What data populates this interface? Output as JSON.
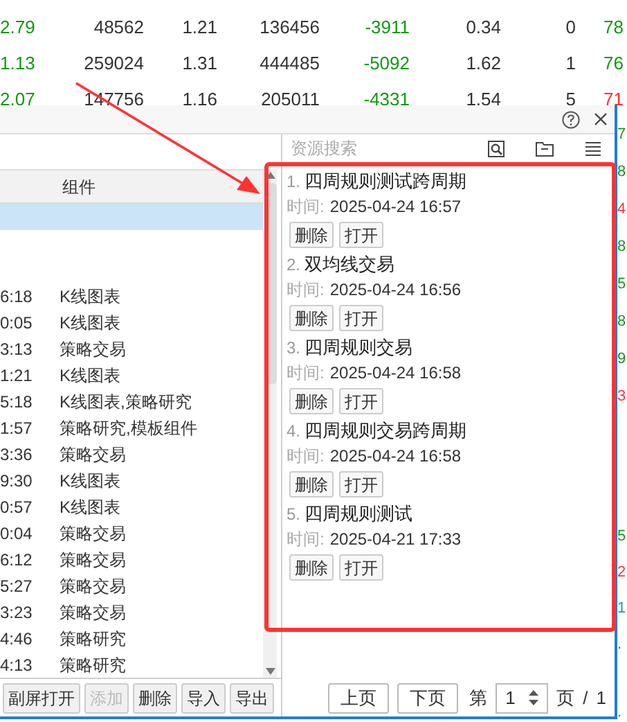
{
  "background_table": {
    "rows": [
      {
        "cells": [
          {
            "text": "2.79",
            "color": "#119911"
          },
          {
            "text": "48562",
            "color": "#333333"
          },
          {
            "text": "1.21",
            "color": "#333333"
          },
          {
            "text": "136456",
            "color": "#333333"
          },
          {
            "text": "-3911",
            "color": "#119911"
          },
          {
            "text": "0.34",
            "color": "#333333"
          },
          {
            "text": "0",
            "color": "#333333"
          },
          {
            "text": "78",
            "color": "#119911"
          }
        ]
      },
      {
        "cells": [
          {
            "text": "1.13",
            "color": "#119911"
          },
          {
            "text": "259024",
            "color": "#333333"
          },
          {
            "text": "1.31",
            "color": "#333333"
          },
          {
            "text": "444485",
            "color": "#333333"
          },
          {
            "text": "-5092",
            "color": "#119911"
          },
          {
            "text": "1.62",
            "color": "#333333"
          },
          {
            "text": "1",
            "color": "#333333"
          },
          {
            "text": "76",
            "color": "#119911"
          }
        ]
      },
      {
        "cells": [
          {
            "text": "2.07",
            "color": "#119911"
          },
          {
            "text": "147756",
            "color": "#333333"
          },
          {
            "text": "1.16",
            "color": "#333333"
          },
          {
            "text": "205011",
            "color": "#333333"
          },
          {
            "text": "-4331",
            "color": "#119911"
          },
          {
            "text": "1.54",
            "color": "#333333"
          },
          {
            "text": "5",
            "color": "#333333"
          },
          {
            "text": "71",
            "color": "#ff3333"
          }
        ]
      }
    ]
  },
  "right_edge_fragments": {
    "upper": [
      {
        "text": "7",
        "color": "#119911"
      },
      {
        "text": "8",
        "color": "#119911"
      },
      {
        "text": "4",
        "color": "#ff3333"
      },
      {
        "text": "8",
        "color": "#119911"
      },
      {
        "text": "5",
        "color": "#119911"
      },
      {
        "text": "8",
        "color": "#119911"
      },
      {
        "text": "9",
        "color": "#119911"
      },
      {
        "text": "3",
        "color": "#ff3333"
      }
    ],
    "lower": [
      {
        "text": "5",
        "color": "#119911"
      },
      {
        "text": "2",
        "color": "#ff3333"
      },
      {
        "text": "1",
        "color": "#1a9fb0"
      },
      {
        "text": ".",
        "color": "#119911"
      }
    ],
    "bottom": [
      {
        "text": ".",
        "color": "#119911"
      }
    ]
  },
  "dialog": {
    "left_panel": {
      "columns": [
        "组件"
      ],
      "rows": [
        {
          "selected": true
        },
        {
          "time": "6:18",
          "component": "K线图表",
          "selected": false
        },
        {
          "time": "0:05",
          "component": "K线图表",
          "selected": false
        },
        {
          "time": "3:13",
          "component": "策略交易",
          "selected": false
        },
        {
          "time": "1:21",
          "component": "K线图表",
          "selected": false
        },
        {
          "time": "5:18",
          "component": "K线图表,策略研究",
          "selected": false
        },
        {
          "time": "1:57",
          "component": "策略研究,模板组件",
          "selected": false
        },
        {
          "time": "3:36",
          "component": "策略交易",
          "selected": false
        },
        {
          "time": "9:30",
          "component": "K线图表",
          "selected": false
        },
        {
          "time": "0:57",
          "component": "K线图表",
          "selected": false
        },
        {
          "time": "0:04",
          "component": "策略交易",
          "selected": false
        },
        {
          "time": "6:12",
          "component": "策略交易",
          "selected": false
        },
        {
          "time": "5:27",
          "component": "策略交易",
          "selected": false
        },
        {
          "time": "3:23",
          "component": "策略交易",
          "selected": false
        },
        {
          "time": "4:46",
          "component": "策略研究",
          "selected": false
        },
        {
          "time": "4:13",
          "component": "策略研究",
          "selected": false
        }
      ],
      "buttons": [
        {
          "label": "副屏打开",
          "disabled": false
        },
        {
          "label": "添加",
          "disabled": true
        },
        {
          "label": "删除",
          "disabled": false
        },
        {
          "label": "导入",
          "disabled": false
        },
        {
          "label": "导出",
          "disabled": false
        }
      ]
    },
    "right_panel": {
      "search": {
        "placeholder": "资源搜索"
      },
      "items": [
        {
          "number": "1.",
          "title": "四周规则测试跨周期",
          "time_label": "时间:",
          "time": "2025-04-24 16:57",
          "buttons": [
            "删除",
            "打开"
          ]
        },
        {
          "number": "2.",
          "title": "双均线交易",
          "time_label": "时间:",
          "time": "2025-04-24 16:56",
          "buttons": [
            "删除",
            "打开"
          ]
        },
        {
          "number": "3.",
          "title": "四周规则交易",
          "time_label": "时间:",
          "time": "2025-04-24 16:58",
          "buttons": [
            "删除",
            "打开"
          ]
        },
        {
          "number": "4.",
          "title": "四周规则交易跨周期",
          "time_label": "时间:",
          "time": "2025-04-24 16:58",
          "buttons": [
            "删除",
            "打开"
          ]
        },
        {
          "number": "5.",
          "title": "四周规则测试",
          "time_label": "时间:",
          "time": "2025-04-21 17:33",
          "buttons": [
            "删除",
            "打开"
          ]
        }
      ],
      "pagination": {
        "prev": "上页",
        "next": "下页",
        "page_prefix": "第",
        "page": "1",
        "page_suffix": "页",
        "separator": "/",
        "total": "1"
      }
    }
  }
}
